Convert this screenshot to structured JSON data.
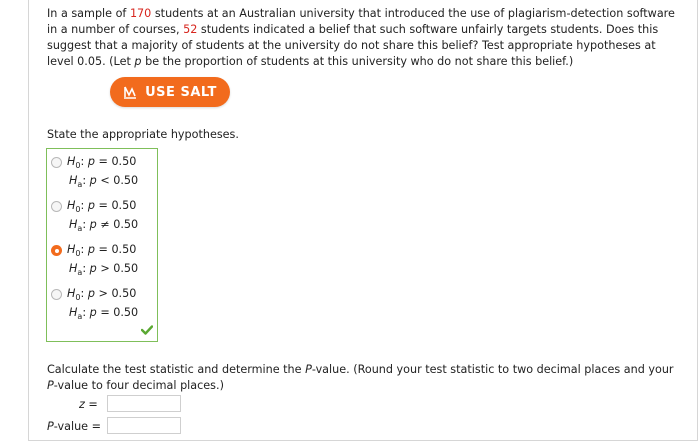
{
  "problem": {
    "t1": "In a sample of ",
    "n": "170",
    "t2": " students at an Australian university that introduced the use of plagiarism-detection software in a number of courses, ",
    "x": "52",
    "t3": " students indicated a belief that such software unfairly targets students. Does this suggest that a majority of students at the university do not share this belief? Test appropriate hypotheses at level 0.05. (Let ",
    "p": "p",
    "t4": " be the proportion of students at this university who do not share this belief.)"
  },
  "salt_button": {
    "label": "USE SALT"
  },
  "hypotheses": {
    "prompt": "State the appropriate hypotheses.",
    "options": [
      {
        "h0_rel": " = 0.50",
        "ha_rel": " < 0.50",
        "selected": false
      },
      {
        "h0_rel": " = 0.50",
        "ha_rel": " ≠ 0.50",
        "selected": false
      },
      {
        "h0_rel": " = 0.50",
        "ha_rel": " > 0.50",
        "selected": true
      },
      {
        "h0_rel": " > 0.50",
        "ha_rel": " = 0.50",
        "selected": false
      }
    ],
    "sym": {
      "H": "H",
      "sub0": "0",
      "suba": "a",
      "colon": ": ",
      "p": "p"
    }
  },
  "calc": {
    "t1": "Calculate the test statistic and determine the ",
    "P": "P",
    "t2": "-value. (Round your test statistic to two decimal places and your ",
    "P2": "P",
    "t3": "-value to four decimal places.)",
    "z_label": "z",
    "eq": " =",
    "pval_label": "P",
    "pval_suffix": "-value",
    "z_value": "",
    "p_value": ""
  },
  "colors": {
    "accent": "#f26b1d",
    "red_value": "#d7261e",
    "correct_border": "#7fbf5a",
    "check": "#5aa832"
  },
  "icons": {
    "salt": "salt-calculator-icon",
    "check": "checkmark-icon"
  }
}
